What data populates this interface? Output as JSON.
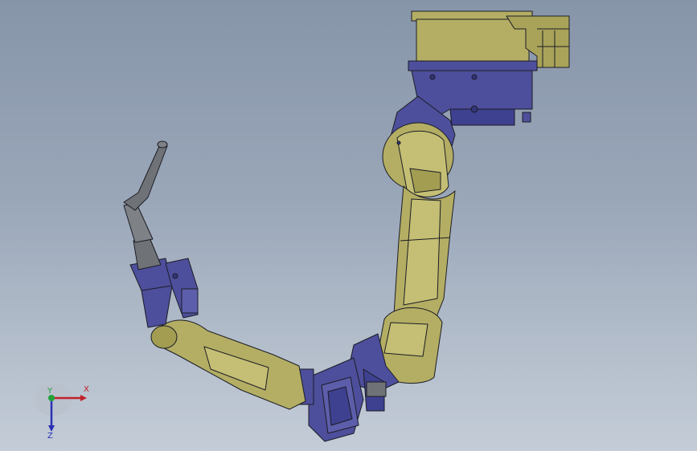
{
  "viewport": {
    "background_top": "#8795a9",
    "background_bottom": "#c3ccd7"
  },
  "model": {
    "colors": {
      "yellow": "#b3ae64",
      "yellow_dark": "#8f8a45",
      "blue": "#4d4f9c",
      "blue_dark": "#33357a",
      "gray": "#6f7378",
      "outline": "#1c1c24"
    }
  },
  "triad": {
    "x_label": "X",
    "y_label": "Y",
    "z_label": "Z",
    "x_color": "#c0202a",
    "y_color": "#21a33a",
    "z_color": "#2a2fb5"
  }
}
